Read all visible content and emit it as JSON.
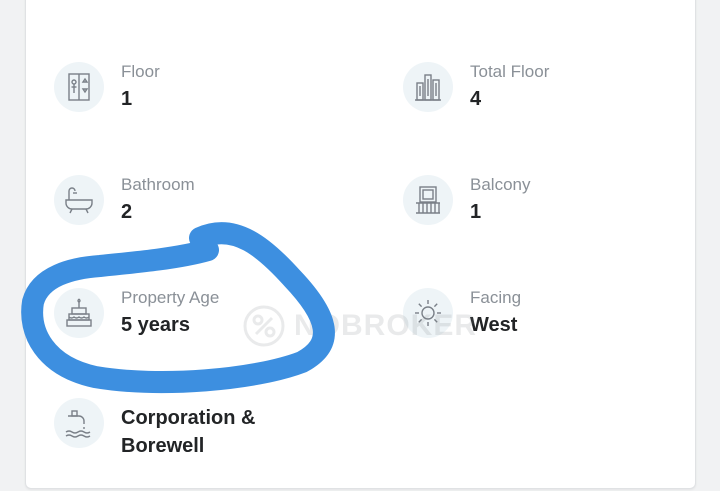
{
  "details": [
    {
      "key": "floor",
      "label": "Floor",
      "value": "1",
      "icon": "elevator-icon"
    },
    {
      "key": "total_floor",
      "label": "Total Floor",
      "value": "4",
      "icon": "building-icon"
    },
    {
      "key": "bathroom",
      "label": "Bathroom",
      "value": "2",
      "icon": "bathtub-icon"
    },
    {
      "key": "balcony",
      "label": "Balcony",
      "value": "1",
      "icon": "balcony-icon"
    },
    {
      "key": "property_age",
      "label": "Property Age",
      "value": "5 years",
      "icon": "cake-icon"
    },
    {
      "key": "facing",
      "label": "Facing",
      "value": "West",
      "icon": "sun-icon"
    },
    {
      "key": "water_supply",
      "value": "Corporation & Borewell",
      "icon": "water-tap-icon"
    }
  ],
  "watermark": {
    "text": "NOBROKER",
    "icon": "nobroker-logo-icon"
  },
  "colors": {
    "icon_stroke": "#7a8088",
    "icon_bg": "#eef4f7",
    "label": "#8a9097",
    "value": "#222426",
    "highlight_scribble": "#3d8fe0"
  }
}
